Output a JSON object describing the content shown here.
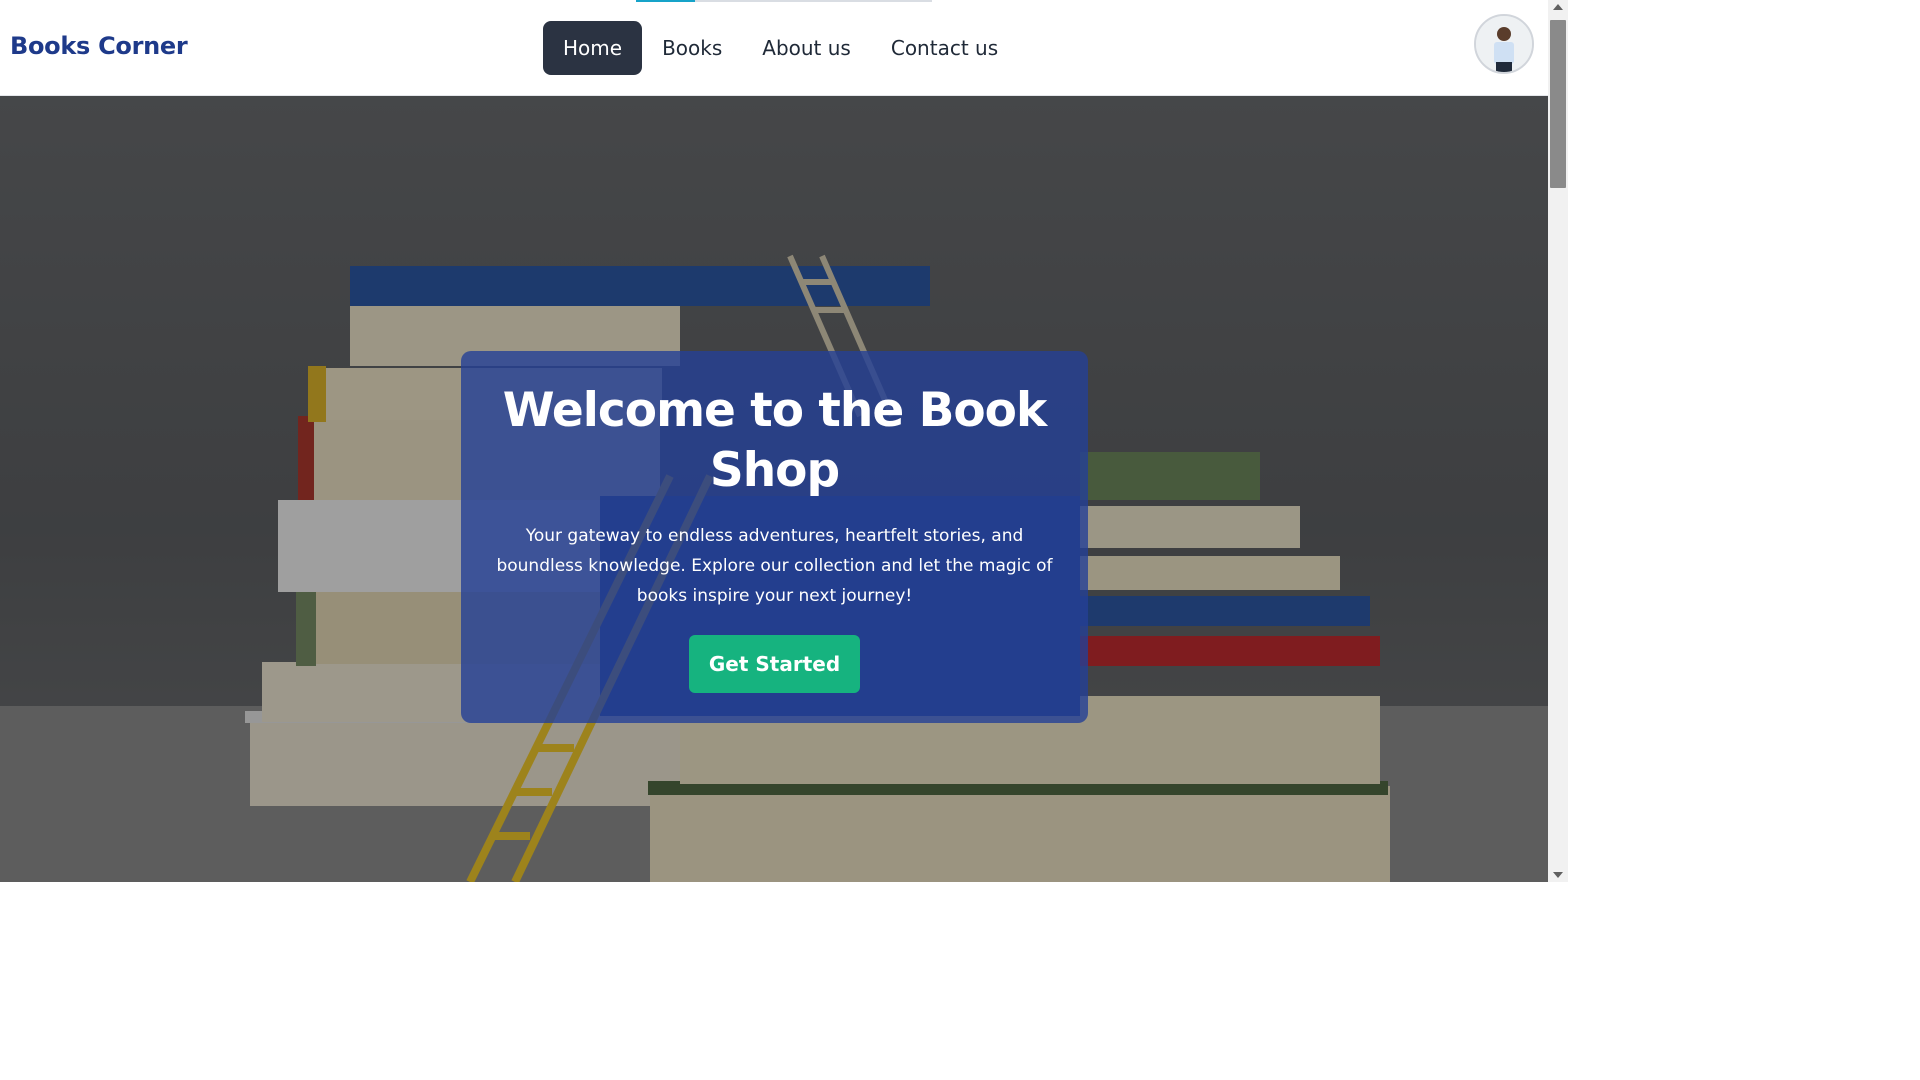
{
  "brand": {
    "name": "Books Corner",
    "color": "#1e3a8a"
  },
  "nav": {
    "items": [
      {
        "label": "Home",
        "active": true
      },
      {
        "label": "Books",
        "active": false
      },
      {
        "label": "About us",
        "active": false
      },
      {
        "label": "Contact us",
        "active": false
      }
    ]
  },
  "user": {
    "avatar_icon": "user-avatar-icon"
  },
  "hero": {
    "title": "Welcome to the Book Shop",
    "description": "Your gateway to endless adventures, heartfelt stories, and boundless knowledge. Explore our collection and let the magic of books inspire your next journey!",
    "cta_label": "Get Started",
    "background_image": "stack-of-books-with-ladder"
  },
  "colors": {
    "accent": "#16b37f",
    "card": "#2440a0",
    "nav_active": "#2b3342"
  }
}
